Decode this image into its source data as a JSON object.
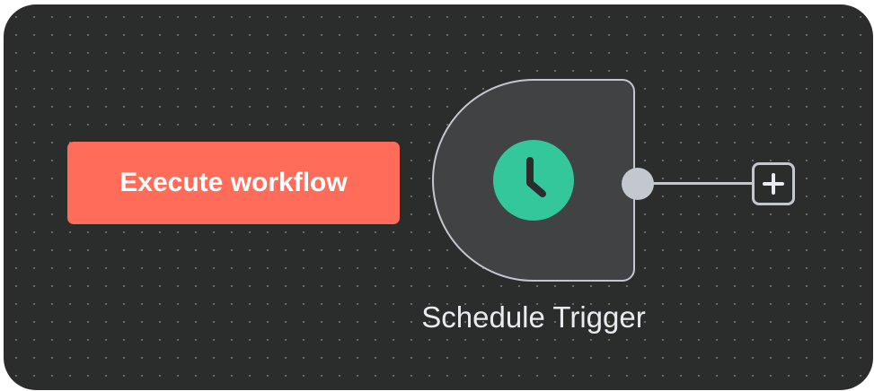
{
  "canvas": {
    "background_color": "#2b2c2c",
    "dot_color": "#6b6d6e"
  },
  "execute_button": {
    "label": "Execute workflow",
    "color": "#ff6d5a"
  },
  "node": {
    "label": "Schedule Trigger",
    "icon": "clock-icon",
    "icon_color": "#35c79c",
    "fill_color": "#414244",
    "border_color": "#c3c7cf"
  },
  "connector": {
    "add_icon": "plus-icon"
  }
}
